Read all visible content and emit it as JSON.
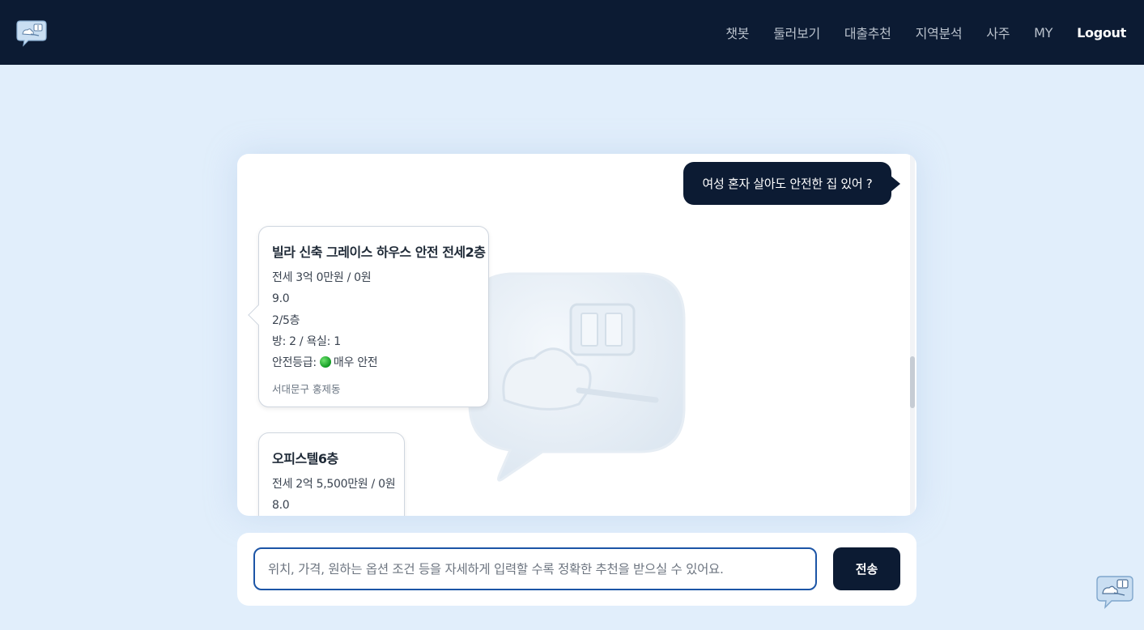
{
  "nav": {
    "logo_icon": "chat-bot-logo-icon",
    "links": [
      "챗봇",
      "둘러보기",
      "대출추천",
      "지역분석",
      "사주",
      "MY"
    ],
    "logout": "Logout"
  },
  "chat": {
    "user_message": "여성 혼자 살아도 안전한 집 있어 ?",
    "cards": [
      {
        "title": "빌라 신축 그레이스 하우스 안전 전세2층",
        "price": "전세 3억 0만원 / 0원",
        "score": "9.0",
        "floor": "2/5층",
        "rooms": "방: 2 / 욕실: 1",
        "safety_label": "안전등급:",
        "safety_value": "매우 안전",
        "location": "서대문구 홍제동"
      },
      {
        "title": "오피스텔6층",
        "price": "전세 2억 5,500만원 / 0원",
        "score": "8.0"
      }
    ],
    "safety_color": "#1aa82a"
  },
  "input": {
    "placeholder": "위치, 가격, 원하는 옵션 조건 등을 자세하게 입력할 수록 정확한 추천을 받으실 수 있어요.",
    "value": "",
    "send_label": "전송"
  },
  "colors": {
    "navbar": "#0c1b33",
    "background": "#e1eefb",
    "accent_border": "#1c55a6"
  }
}
